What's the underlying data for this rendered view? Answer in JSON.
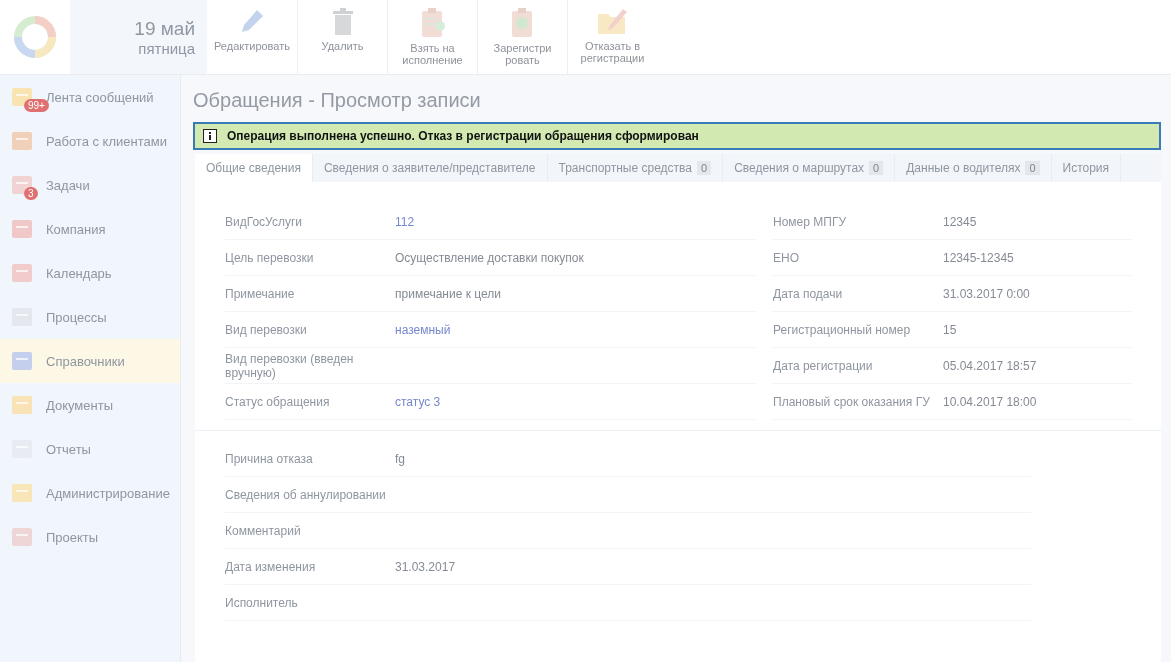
{
  "header": {
    "date": "19 май",
    "weekday": "пятница"
  },
  "toolbar": [
    {
      "label": "Редактировать"
    },
    {
      "label": "Удалить"
    },
    {
      "label": "Взять на исполнение"
    },
    {
      "label": "Зарегистри ровать"
    },
    {
      "label": "Отказать в регистрации"
    }
  ],
  "sidebar": {
    "items": [
      {
        "label": "Лента сообщений",
        "selected": false,
        "badge": "99+"
      },
      {
        "label": "Работа с клиентами",
        "selected": false
      },
      {
        "label": "Задачи",
        "selected": false,
        "badge": "3"
      },
      {
        "label": "Компания",
        "selected": false
      },
      {
        "label": "Календарь",
        "selected": false
      },
      {
        "label": "Процессы",
        "selected": false
      },
      {
        "label": "Справочники",
        "selected": true
      },
      {
        "label": "Документы",
        "selected": false
      },
      {
        "label": "Отчеты",
        "selected": false
      },
      {
        "label": "Администрирование",
        "selected": false
      },
      {
        "label": "Проекты",
        "selected": false
      }
    ]
  },
  "page_title": "Обращения - Просмотр записи",
  "notice": "Операция выполнена успешно. Отказ в регистрации обращения сформирован",
  "tabs": [
    {
      "label": "Общие сведения",
      "selected": true
    },
    {
      "label": "Сведения о заявителе/представителе",
      "selected": false
    },
    {
      "label": "Транспортные средства",
      "count": "0",
      "selected": false
    },
    {
      "label": "Сведения о маршрутах",
      "count": "0",
      "selected": false
    },
    {
      "label": "Данные о водителях",
      "count": "0",
      "selected": false
    },
    {
      "label": "История",
      "selected": false
    }
  ],
  "left_fields": [
    {
      "label": "ВидГосУслуги",
      "value": "112",
      "kind": "link"
    },
    {
      "label": "Цель перевозки",
      "value": "Осуществление доставки покупок",
      "kind": "text"
    },
    {
      "label": "Примечание",
      "value": "примечание к цели",
      "kind": "text"
    },
    {
      "label": "Вид перевозки",
      "value": "наземный",
      "kind": "link"
    },
    {
      "label": "Вид перевозки (введен вручную)"
    },
    {
      "label": "Статус обращения",
      "value": "статус 3",
      "kind": "link"
    }
  ],
  "right_fields": [
    {
      "label": "Номер МПГУ",
      "value": "12345",
      "kind": "text"
    },
    {
      "label": "ЕНО",
      "value": "12345-12345",
      "kind": "text"
    },
    {
      "label": "Дата подачи",
      "value": "31.03.2017 0:00",
      "kind": "text"
    },
    {
      "label": "Регистрационный номер",
      "value": "15",
      "kind": "text"
    },
    {
      "label": "Дата регистрации",
      "value": "05.04.2017 18:57",
      "kind": "text"
    },
    {
      "label": "Плановый срок оказания ГУ",
      "value": "10.04.2017 18:00",
      "kind": "text"
    }
  ],
  "bottom_fields": [
    {
      "label": "Причина отказа",
      "value": "fg",
      "kind": "text"
    },
    {
      "label": "Сведения об аннулировании"
    },
    {
      "label": "Комментарий"
    },
    {
      "label": "Дата изменения",
      "value": "31.03.2017",
      "kind": "text"
    },
    {
      "label": "Исполнитель"
    }
  ]
}
